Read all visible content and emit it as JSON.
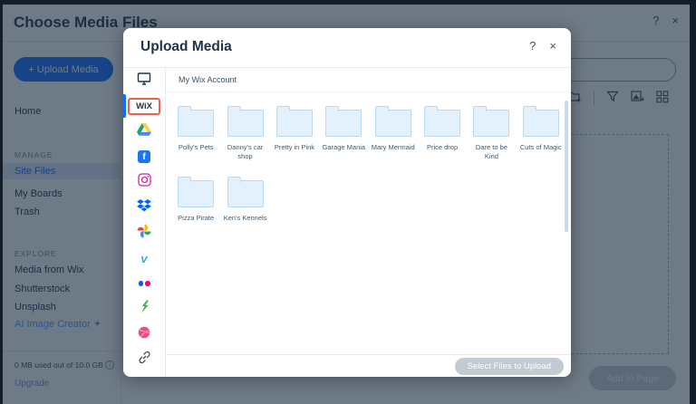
{
  "app": {
    "title": "Choose Media Files",
    "help_icon": "?",
    "close_icon": "×",
    "upload_button_label": "+ Upload Media",
    "home_item": "Home",
    "manage_section": {
      "label": "MANAGE",
      "items": [
        "Site Files",
        "My Boards",
        "Trash"
      ],
      "selected": "Site Files"
    },
    "explore_section": {
      "label": "EXPLORE",
      "items": [
        "Media from Wix",
        "Shutterstock",
        "Unsplash",
        "AI Image Creator"
      ]
    },
    "storage_text": "0 MB used out of 10.0 GB",
    "upgrade_link": "Upgrade",
    "add_to_page_button": "Add to Page"
  },
  "modal": {
    "title": "Upload Media",
    "help_icon": "?",
    "close_icon": "×",
    "wix_tab_label": "WiX",
    "active_tab": "wix",
    "source_tabs": [
      "my-computer",
      "wix",
      "google-drive",
      "facebook",
      "instagram",
      "dropbox",
      "google-photos",
      "vimeo",
      "flickr",
      "deviantart",
      "dribbble",
      "link"
    ],
    "breadcrumb": "My Wix Account",
    "folders": [
      "Polly's Pets",
      "Danny's car shop",
      "Pretty in Pink",
      "Garage Mania",
      "Mary Mermaid",
      "Price drop",
      "Dare to be Kind",
      "Cuts of Magic",
      "Pizza Pirate",
      "Ken's Kennels"
    ],
    "upload_button_label": "Select Files to Upload"
  },
  "icons": {
    "facebook_glyph": "f",
    "vimeo_glyph": "v",
    "sparkle": "✦",
    "info": "i"
  },
  "colors": {
    "accent_blue": "#116dff",
    "wix_highlight_box": "#e8654a",
    "folder_fill": "#e3f1fc",
    "folder_border": "#b9daf3",
    "disabled_button": "#c2cbd3",
    "overlay": "rgba(25,45,64,0.63)"
  }
}
